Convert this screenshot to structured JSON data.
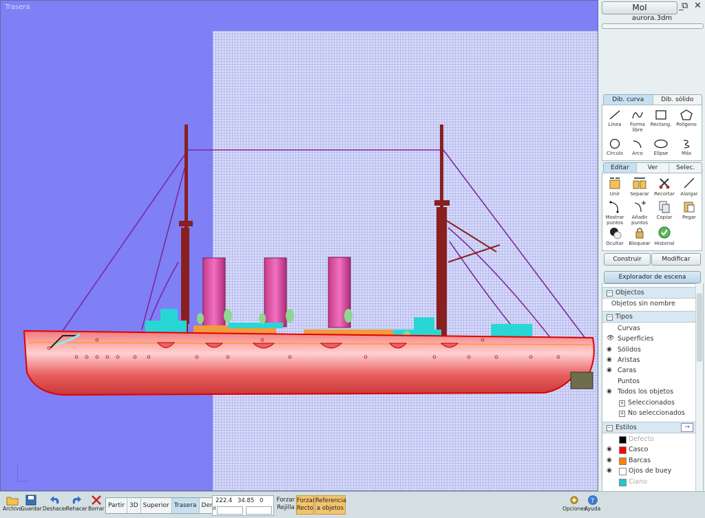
{
  "viewport": {
    "label": "Trasera"
  },
  "app": {
    "title": "MoI",
    "filename": "aurora.3dm",
    "minimize": "_",
    "restore": "⧉",
    "close": "✕"
  },
  "draw_tabs": [
    "Dib. curva",
    "Dib. sólido"
  ],
  "draw_tools": [
    {
      "label": "Línea",
      "icon": "line-icon"
    },
    {
      "label": "Forma libre",
      "icon": "freeform-icon"
    },
    {
      "label": "Rectang.",
      "icon": "rectangle-icon"
    },
    {
      "label": "Polígono",
      "icon": "polygon-icon"
    },
    {
      "label": "Círculo",
      "icon": "circle-icon"
    },
    {
      "label": "Arco",
      "icon": "arc-icon"
    },
    {
      "label": "Elipse",
      "icon": "ellipse-icon"
    },
    {
      "label": "Más",
      "icon": "more-icon"
    }
  ],
  "edit_tabs": [
    "Editar",
    "Ver",
    "Selec."
  ],
  "edit_tools": [
    {
      "label": "Unir",
      "icon": "join-icon"
    },
    {
      "label": "Separar",
      "icon": "separate-icon"
    },
    {
      "label": "Recortar",
      "icon": "trim-icon"
    },
    {
      "label": "Alargar",
      "icon": "extend-icon"
    },
    {
      "label": "Mostrar puntos",
      "icon": "show-points-icon"
    },
    {
      "label": "Añadir puntos",
      "icon": "add-points-icon"
    },
    {
      "label": "Copiar",
      "icon": "copy-icon"
    },
    {
      "label": "Pegar",
      "icon": "paste-icon"
    },
    {
      "label": "Ocultar",
      "icon": "hide-icon"
    },
    {
      "label": "Bloquear",
      "icon": "lock-icon"
    },
    {
      "label": "Historial",
      "icon": "history-icon"
    }
  ],
  "construct": {
    "construir": "Construir",
    "modificar": "Modificar"
  },
  "explorer": {
    "title": "Explorador de escena",
    "objects_header": "Objectos",
    "objects_item": "Objetos sin nombre",
    "types_header": "Tipos",
    "types": [
      {
        "label": "Curvas",
        "eye": false
      },
      {
        "label": "Superficies",
        "eye": true
      },
      {
        "label": "Sólidos",
        "eye": true
      },
      {
        "label": "Aristas",
        "eye": true
      },
      {
        "label": "Caras",
        "eye": true
      },
      {
        "label": "Puntos",
        "eye": false
      },
      {
        "label": "Todos los objetos",
        "eye": true
      }
    ],
    "selected": "Seleccionados",
    "not_selected": "No seleccionados",
    "styles_header": "Estilos",
    "styles": [
      {
        "label": "Defecto",
        "color": "#000000",
        "dim": true,
        "eye": false
      },
      {
        "label": "Casco",
        "color": "#ff0000",
        "dim": false,
        "eye": true
      },
      {
        "label": "Barcas",
        "color": "#ff8000",
        "dim": false,
        "eye": true
      },
      {
        "label": "Ojos de buey",
        "color": "#ffffff",
        "dim": false,
        "eye": true
      },
      {
        "label": "Ciano",
        "color": "#20c8c8",
        "dim": true,
        "eye": false
      }
    ]
  },
  "bottom": {
    "archivo": "Archivo",
    "guardar": "Guardar",
    "deshacer": "Deshacer",
    "rehacer": "Rehacer",
    "borrar": "Borrar",
    "views": [
      "Partir",
      "3D",
      "Superior",
      "Trasera",
      "Derecha"
    ],
    "active_view": "Trasera",
    "coord_x": "222.4",
    "coord_y": "34.85",
    "coord_z": "0",
    "coord_d": "d",
    "forzar_rejilla": "Forzar Rejilla",
    "forzar_recto": "Forzar Recto",
    "referencia": "Referencia a objetos",
    "opciones": "Opciones",
    "ayuda": "Ayuda"
  }
}
